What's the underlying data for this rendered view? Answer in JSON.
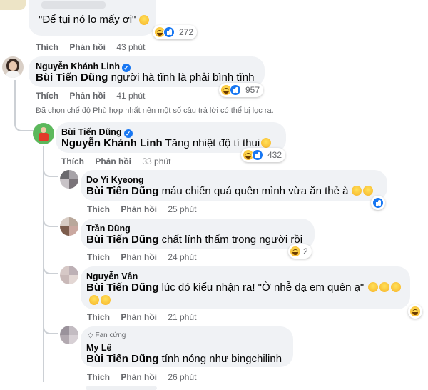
{
  "comments": [
    {
      "text": "\"Để tụi nó lo mấy ơi\"",
      "react_count": "272",
      "actions": {
        "like": "Thích",
        "reply": "Phản hồi",
        "time": "43 phút"
      }
    },
    {
      "author": "Nguyễn Khánh Linh",
      "mention": "Bùi Tiến Dũng",
      "text": "người hà tĩnh là phải bình tĩnh",
      "react_count": "957",
      "actions": {
        "like": "Thích",
        "reply": "Phản hồi",
        "time": "41 phút"
      }
    },
    {
      "author": "Bùi Tiến Dũng",
      "mention": "Nguyễn Khánh Linh",
      "text": "Tăng nhiệt độ tí thui",
      "react_count": "432",
      "actions": {
        "like": "Thích",
        "reply": "Phản hồi",
        "time": "33 phút"
      }
    },
    {
      "author": "Do Yi Kyeong",
      "mention": "Bùi Tiến Dũng",
      "text": "máu chiến quá quên mình vừa ăn thẻ à",
      "actions": {
        "like": "Thích",
        "reply": "Phản hồi",
        "time": "25 phút"
      }
    },
    {
      "author": "Trần Dũng",
      "mention": "Bùi Tiến Dũng",
      "text": "chất lính thấm trong người rồi",
      "react_count": "2",
      "actions": {
        "like": "Thích",
        "reply": "Phản hồi",
        "time": "24 phút"
      }
    },
    {
      "author": "Nguyễn Vân",
      "mention": "Bùi Tiến Dũng",
      "text": "lúc đó kiểu nhận ra! \"Ờ nhễ dạ em quên ạ\"",
      "actions": {
        "like": "Thích",
        "reply": "Phản hồi",
        "time": "21 phút"
      }
    },
    {
      "badge": "Fan cứng",
      "author": "My Lê",
      "mention": "Bùi Tiến Dũng",
      "text": "tính nóng như bingchilinh",
      "actions": {
        "like": "Thích",
        "reply": "Phản hồi",
        "time": "26 phút"
      }
    }
  ],
  "filter_notice": "Đã chọn chế độ Phù hợp nhất nên một số câu trả lời có thể bị lọc ra.",
  "colors": {
    "bubble": "#f0f2f5",
    "link_blue": "#1877f2",
    "meta_gray": "#65676b",
    "thread_line": "#ccd0d5"
  },
  "icons": {
    "verified": "verified-badge-icon",
    "haha": "haha-reaction-icon",
    "like": "like-reaction-icon",
    "fan": "diamond-icon"
  }
}
